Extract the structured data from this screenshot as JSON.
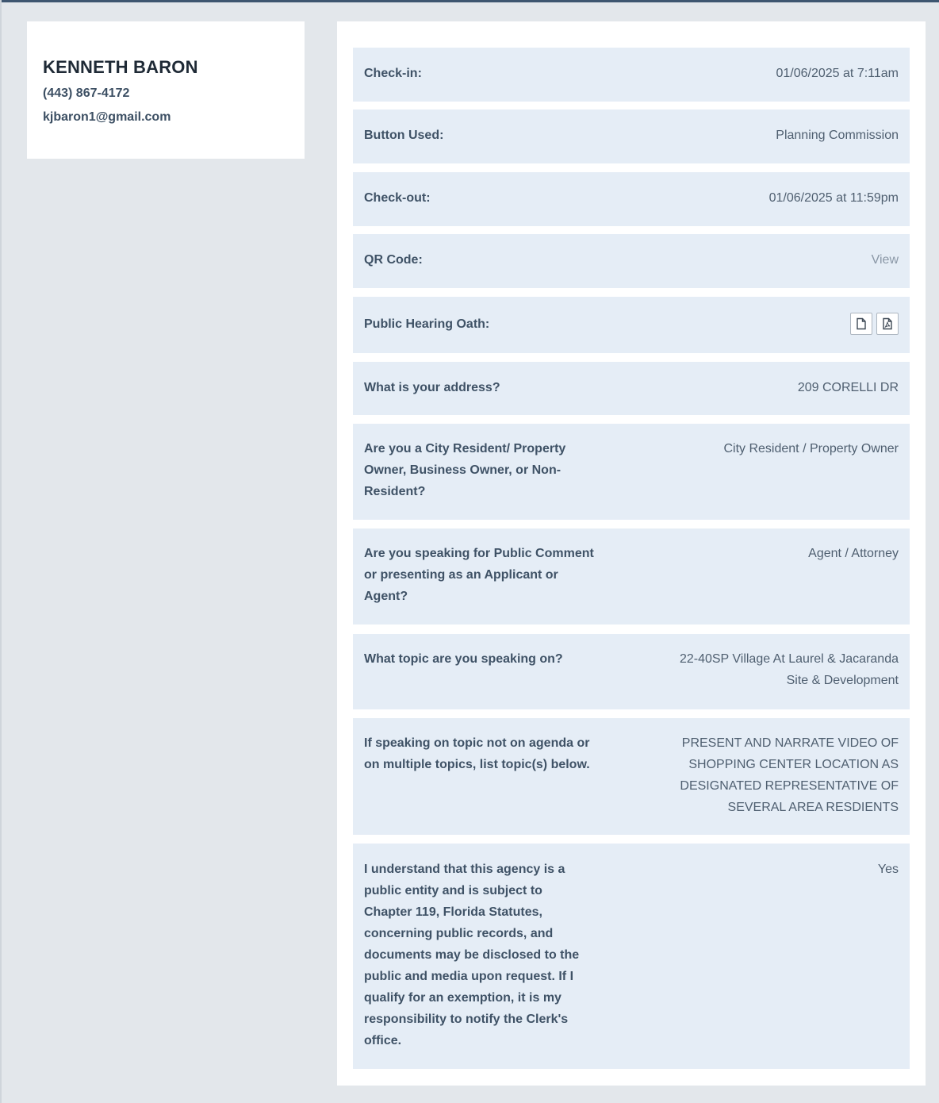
{
  "profile": {
    "name": "KENNETH BARON",
    "phone": "(443) 867-4172",
    "email": "kjbaron1@gmail.com"
  },
  "details": {
    "checkin": {
      "label": "Check-in:",
      "value": "01/06/2025 at 7:11am"
    },
    "button_used": {
      "label": "Button Used:",
      "value": "Planning Commission"
    },
    "checkout": {
      "label": "Check-out:",
      "value": "01/06/2025 at 11:59pm"
    },
    "qr_code": {
      "label": "QR Code:",
      "value": "View"
    },
    "oath": {
      "label": "Public Hearing Oath:",
      "icons": [
        "document-icon",
        "pdf-icon"
      ]
    },
    "address": {
      "label": "What is your address?",
      "value": "209 CORELLI DR"
    },
    "resident": {
      "label_lines": [
        "Are you a City Resident/ Property",
        "Owner, Business Owner, or Non-",
        "Resident?"
      ],
      "value": "City Resident / Property Owner"
    },
    "speaking_role": {
      "label_lines": [
        "Are you speaking for Public Comment",
        "or presenting as an Applicant or",
        "Agent?"
      ],
      "value": "Agent / Attorney"
    },
    "topic": {
      "label": "What topic are you speaking on?",
      "value_lines": [
        "22-40SP Village At Laurel & Jacaranda",
        "Site & Development"
      ]
    },
    "other_topic": {
      "label_lines": [
        "If speaking on topic not on agenda or",
        "on multiple topics, list topic(s) below."
      ],
      "value_lines": [
        "PRESENT AND NARRATE VIDEO OF",
        "SHOPPING CENTER LOCATION AS",
        "DESIGNATED REPRESENTATIVE OF",
        "SEVERAL AREA RESDIENTS"
      ]
    },
    "public_records": {
      "label_lines": [
        "I understand that this agency is a",
        "public entity and is subject to",
        "Chapter 119, Florida Statutes,",
        "concerning public records, and",
        "documents may be disclosed to the",
        "public and media upon request. If I",
        "qualify for an exemption, it is my",
        "responsibility to notify the Clerk's",
        "office."
      ],
      "value": "Yes"
    }
  }
}
